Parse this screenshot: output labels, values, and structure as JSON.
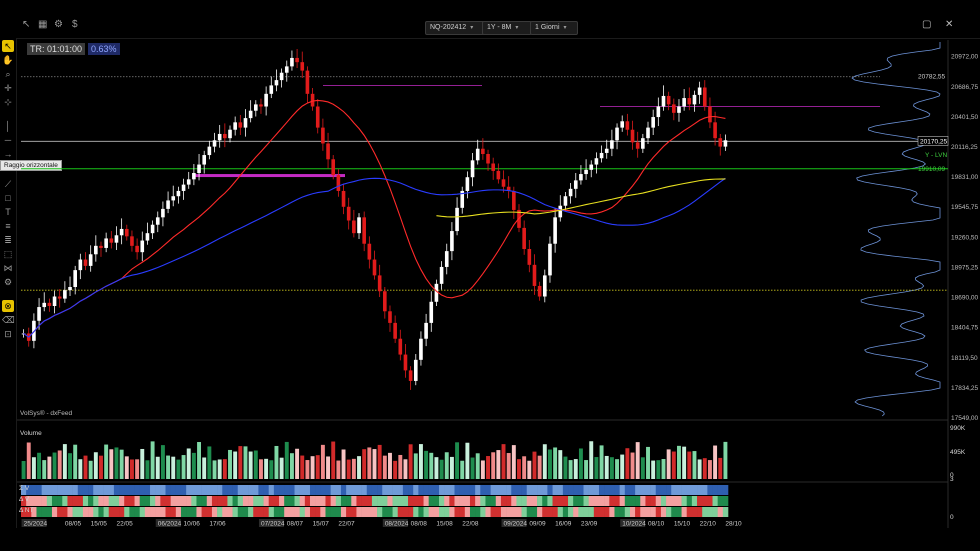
{
  "toolbar": {
    "symbol": "NQ-202412",
    "timeframe": "1Y - 8M",
    "interval": "1 Giorni",
    "icons": [
      "pointer-icon",
      "grid-icon",
      "settings-icon",
      "dollar-icon"
    ]
  },
  "info": {
    "tr": "TR: 01:01:00",
    "pct": "0.63%"
  },
  "tooltip": "Raggio orizzontale",
  "feed": "VolSys® - dxFeed",
  "price_labels": [
    {
      "text": "20972,00",
      "price": 20972
    },
    {
      "text": "20686,75",
      "price": 20687
    },
    {
      "text": "20401,50",
      "price": 20401.5
    },
    {
      "text": "20116,25",
      "price": 20116
    },
    {
      "text": "19831,00",
      "price": 19831
    },
    {
      "text": "19545,75",
      "price": 19546
    },
    {
      "text": "19260,50",
      "price": 19260.5
    },
    {
      "text": "18975,25",
      "price": 18975
    },
    {
      "text": "18690,00",
      "price": 18690
    },
    {
      "text": "18404,75",
      "price": 18405
    },
    {
      "text": "18119,50",
      "price": 18119.5
    },
    {
      "text": "17834,25",
      "price": 17834
    },
    {
      "text": "17549,00",
      "price": 17549
    }
  ],
  "markers": [
    {
      "text": "20782,55",
      "price": 20782,
      "color": "#cfcfcf"
    },
    {
      "text": "20170,25",
      "price": 20170,
      "color": "#ffffff",
      "boxed": true
    },
    {
      "text": "Y - LVN",
      "price": 20040,
      "color": "#3fd13f"
    },
    {
      "text": "19910,09",
      "price": 19910,
      "color": "#3fd13f"
    }
  ],
  "volume": {
    "title": "Volume",
    "scale": [
      "990K",
      "495K",
      "0"
    ]
  },
  "heatmap": {
    "rows": [
      "Σ V",
      "Δ V",
      "Δ NT"
    ],
    "scale": [
      "3",
      "0"
    ]
  },
  "dates": [
    {
      "text": "25/2024",
      "idx": 0,
      "boxed": true
    },
    {
      "text": "08/05",
      "idx": 8
    },
    {
      "text": "15/05",
      "idx": 13
    },
    {
      "text": "22/05",
      "idx": 18
    },
    {
      "text": "06/2024",
      "idx": 26,
      "boxed": true
    },
    {
      "text": "10/06",
      "idx": 31
    },
    {
      "text": "17/06",
      "idx": 36
    },
    {
      "text": "07/2024",
      "idx": 46,
      "boxed": true
    },
    {
      "text": "08/07",
      "idx": 51
    },
    {
      "text": "15/07",
      "idx": 56
    },
    {
      "text": "22/07",
      "idx": 61
    },
    {
      "text": "08/2024",
      "idx": 70,
      "boxed": true
    },
    {
      "text": "08/08",
      "idx": 75
    },
    {
      "text": "15/08",
      "idx": 80
    },
    {
      "text": "22/08",
      "idx": 85
    },
    {
      "text": "09/2024",
      "idx": 93,
      "boxed": true
    },
    {
      "text": "09/09",
      "idx": 98
    },
    {
      "text": "16/09",
      "idx": 103
    },
    {
      "text": "23/09",
      "idx": 108
    },
    {
      "text": "10/2024",
      "idx": 116,
      "boxed": true
    },
    {
      "text": "08/10",
      "idx": 121
    },
    {
      "text": "15/10",
      "idx": 126
    },
    {
      "text": "22/10",
      "idx": 131
    },
    {
      "text": "28/10",
      "idx": 136
    }
  ],
  "colors": {
    "up": "#ffffff",
    "down": "#e11b1b",
    "ma_fast": "#ff2a2a",
    "ma_slow": "#2a3cff",
    "ma_long": "#e8e020",
    "profile": "#6d93d8",
    "level_green": "#19c419",
    "level_magenta": "#c52bc5"
  },
  "chart_data": {
    "type": "candlestick",
    "title": "",
    "ylim": [
      17549,
      21130
    ],
    "start_close": 18350,
    "closes": [
      18350,
      18280,
      18470,
      18600,
      18640,
      18610,
      18700,
      18680,
      18760,
      18790,
      18950,
      19050,
      18990,
      19100,
      19180,
      19160,
      19250,
      19210,
      19280,
      19340,
      19270,
      19180,
      19120,
      19230,
      19300,
      19380,
      19450,
      19530,
      19610,
      19650,
      19700,
      19760,
      19810,
      19870,
      19950,
      20040,
      20120,
      20180,
      20240,
      20200,
      20280,
      20350,
      20300,
      20390,
      20460,
      20520,
      20500,
      20620,
      20700,
      20750,
      20820,
      20880,
      20960,
      20920,
      20840,
      20620,
      20500,
      20300,
      20150,
      20000,
      19850,
      19700,
      19550,
      19420,
      19300,
      19450,
      19200,
      19050,
      18900,
      18750,
      18560,
      18450,
      18300,
      18150,
      18000,
      17900,
      18100,
      18300,
      18450,
      18650,
      18820,
      18980,
      19130,
      19320,
      19540,
      19700,
      19830,
      19990,
      20100,
      20050,
      19960,
      19890,
      19810,
      19740,
      19700,
      19520,
      19350,
      19150,
      19000,
      18800,
      18700,
      18900,
      19200,
      19450,
      19560,
      19650,
      19720,
      19800,
      19860,
      19900,
      19950,
      20010,
      20060,
      20100,
      20180,
      20300,
      20360,
      20280,
      20160,
      20100,
      20200,
      20300,
      20400,
      20500,
      20600,
      20520,
      20440,
      20500,
      20580,
      20520,
      20610,
      20680,
      20500,
      20350,
      20200,
      20120,
      20180
    ],
    "levels": [
      {
        "price": 19910,
        "color": "#19c419",
        "style": "solid"
      },
      {
        "price": 20170,
        "color": "#bbbbbb",
        "style": "solid"
      },
      {
        "price": 20782,
        "color": "#888888",
        "style": "dotted"
      },
      {
        "price": 20700,
        "color": "#c52bc5",
        "style": "solid"
      },
      {
        "price": 20500,
        "color": "#c52bc5",
        "style": "solid"
      },
      {
        "price": 18760,
        "color": "#c9c21e",
        "style": "dotted"
      }
    ]
  }
}
